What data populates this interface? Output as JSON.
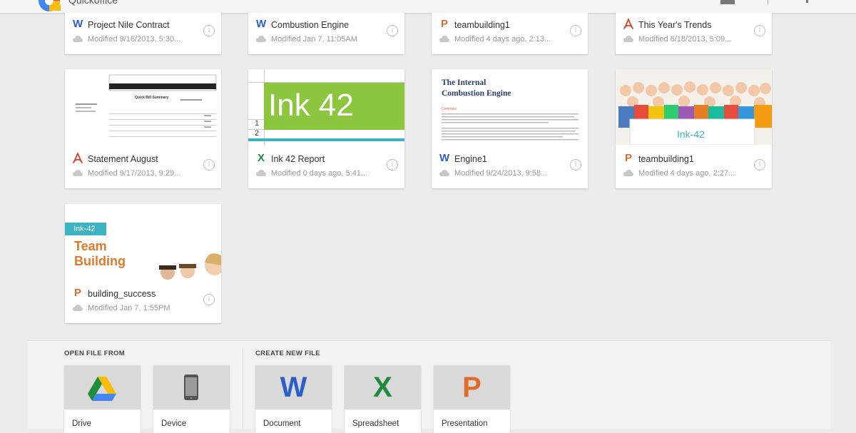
{
  "app": {
    "title": "Quickoffice"
  },
  "files": [
    {
      "name": "Project Nile Contract",
      "modified": "Modified 9/16/2013, 5:30...",
      "type": "word",
      "glyph": "W"
    },
    {
      "name": "Combustion Engine",
      "modified": "Modified Jan 7, 11:05AM",
      "type": "word",
      "glyph": "W"
    },
    {
      "name": "teambuilding1",
      "modified": "Modified 4 days ago, 2:13...",
      "type": "powerpoint",
      "glyph": "P"
    },
    {
      "name": "This Year's Trends",
      "modified": "Modified 6/18/2013, 5:09...",
      "type": "pdf",
      "glyph": "pdf"
    },
    {
      "name": "Statement August",
      "modified": "Modified 9/17/2013, 9:29...",
      "type": "pdf",
      "glyph": "pdf"
    },
    {
      "name": "Ink 42 Report",
      "modified": "Modified 0 days ago, 5:41...",
      "type": "excel",
      "glyph": "X"
    },
    {
      "name": "Engine1",
      "modified": "Modified 9/24/2013, 9:58...",
      "type": "word",
      "glyph": "W"
    },
    {
      "name": "teambuilding1",
      "modified": "Modified 4 days ago, 2:27...",
      "type": "powerpoint",
      "glyph": "P"
    },
    {
      "name": "building_success",
      "modified": "Modified Jan 7, 1:55PM",
      "type": "powerpoint",
      "glyph": "P"
    }
  ],
  "thumbnails": {
    "ink42_text": "Ink 42",
    "ink42_rows": [
      "1",
      "2"
    ],
    "engine_title_line1": "The Internal",
    "engine_title_line2": "Combustion Engine",
    "engine_heading": "Overview",
    "people_banner": "Ink-42",
    "team_tag": "Ink-42",
    "team_title_line1": "Team",
    "team_title_line2": "Building",
    "statement_heading": "Quick Bill Summary"
  },
  "open_from": {
    "label": "OPEN FILE FROM",
    "items": [
      {
        "label": "Drive",
        "icon": "drive-icon"
      },
      {
        "label": "Device",
        "icon": "phone-icon"
      }
    ]
  },
  "create_new": {
    "label": "CREATE NEW FILE",
    "items": [
      {
        "label": "Document",
        "glyph": "W",
        "icon": "word-icon"
      },
      {
        "label": "Spreadsheet",
        "glyph": "X",
        "icon": "excel-icon"
      },
      {
        "label": "Presentation",
        "glyph": "P",
        "icon": "powerpoint-icon"
      }
    ]
  },
  "colors": {
    "word": "#2b5fc7",
    "excel": "#1e8a3c",
    "powerpoint": "#e06b2a",
    "pdf": "#d8432f",
    "ink_green": "#8cc63f",
    "ink_teal": "#3bb3c3"
  }
}
